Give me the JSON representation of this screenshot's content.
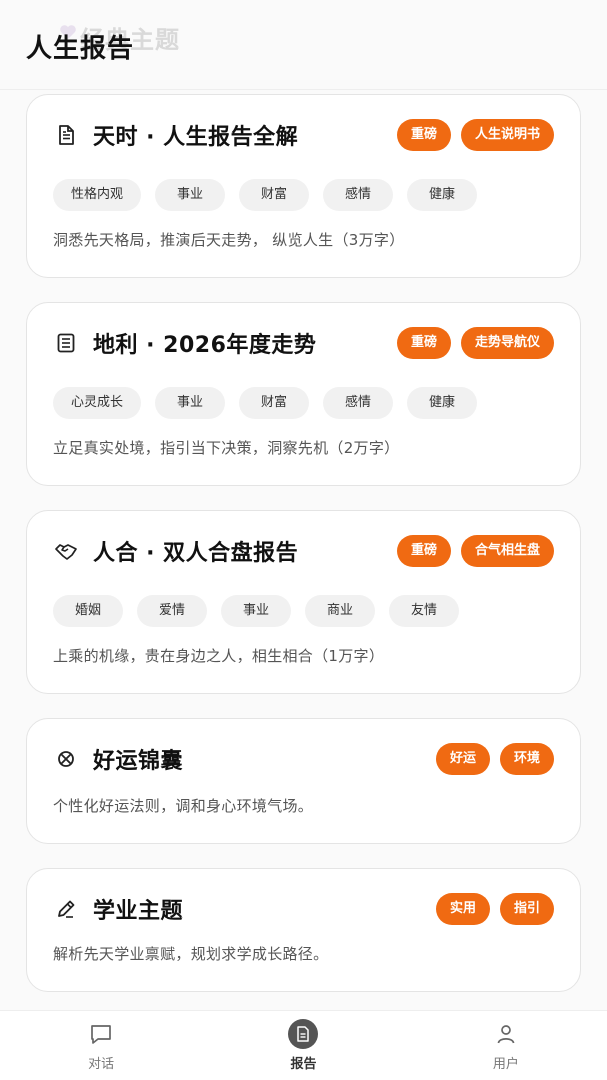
{
  "header": {
    "ghost_title": "经典主题",
    "title": "人生报告"
  },
  "cards": [
    {
      "icon": "document-icon",
      "title": "天时 · 人生报告全解",
      "badges": [
        "重磅",
        "人生说明书"
      ],
      "tags": [
        "性格内观",
        "事业",
        "财富",
        "感情",
        "健康"
      ],
      "desc": "洞悉先天格局，推演后天走势， 纵览人生（3万字）"
    },
    {
      "icon": "list-doc-icon",
      "title": "地利 · 2026年度走势",
      "badges": [
        "重磅",
        "走势导航仪"
      ],
      "tags": [
        "心灵成长",
        "事业",
        "财富",
        "感情",
        "健康"
      ],
      "desc": "立足真实处境，指引当下决策，洞察先机（2万字）"
    },
    {
      "icon": "handshake-icon",
      "title": "人合 · 双人合盘报告",
      "badges": [
        "重磅",
        "合气相生盘"
      ],
      "tags": [
        "婚姻",
        "爱情",
        "事业",
        "商业",
        "友情"
      ],
      "desc": "上乘的机缘，贵在身边之人，相生相合（1万字）"
    },
    {
      "icon": "clover-icon",
      "title": "好运锦囊",
      "badges": [
        "好运",
        "环境"
      ],
      "tags": [],
      "desc": "个性化好运法则，调和身心环境气场。"
    },
    {
      "icon": "pencil-icon",
      "title": "学业主题",
      "badges": [
        "实用",
        "指引"
      ],
      "tags": [],
      "desc": "解析先天学业禀赋，规划求学成长路径。"
    }
  ],
  "tabbar": {
    "tabs": [
      {
        "label": "对话",
        "icon": "chat-icon"
      },
      {
        "label": "报告",
        "icon": "report-icon"
      },
      {
        "label": "用户",
        "icon": "user-icon"
      }
    ],
    "active": "报告"
  },
  "colors": {
    "accent": "#f06a12",
    "tag_bg": "#f1f1f1"
  }
}
